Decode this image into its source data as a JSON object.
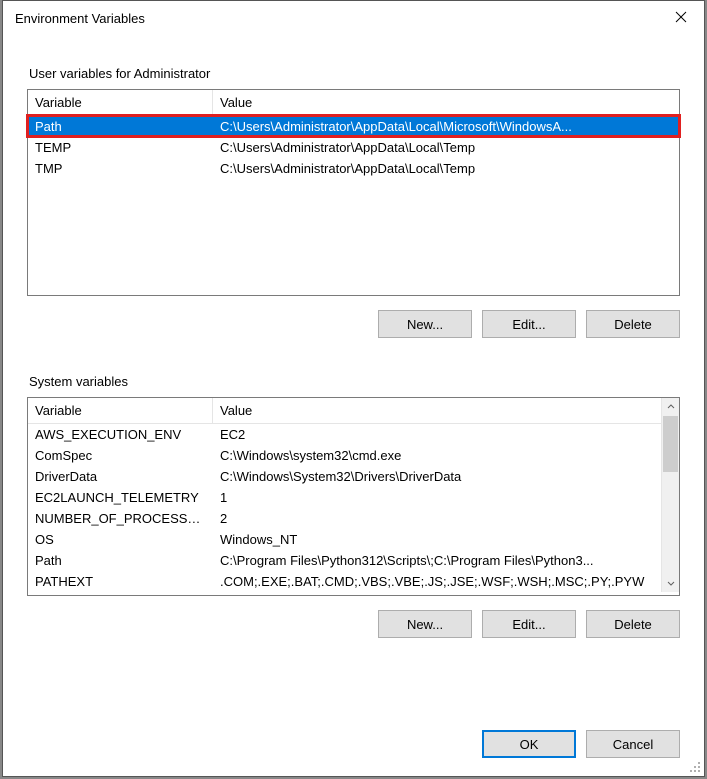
{
  "window": {
    "title": "Environment Variables"
  },
  "user_section": {
    "label": "User variables for Administrator",
    "headers": {
      "variable": "Variable",
      "value": "Value"
    },
    "rows": [
      {
        "variable": "Path",
        "value": "C:\\Users\\Administrator\\AppData\\Local\\Microsoft\\WindowsA...",
        "selected": true,
        "highlight": true
      },
      {
        "variable": "TEMP",
        "value": "C:\\Users\\Administrator\\AppData\\Local\\Temp",
        "selected": false
      },
      {
        "variable": "TMP",
        "value": "C:\\Users\\Administrator\\AppData\\Local\\Temp",
        "selected": false
      }
    ],
    "buttons": {
      "new": "New...",
      "edit": "Edit...",
      "delete": "Delete"
    }
  },
  "system_section": {
    "label": "System variables",
    "headers": {
      "variable": "Variable",
      "value": "Value"
    },
    "rows": [
      {
        "variable": "AWS_EXECUTION_ENV",
        "value": "EC2"
      },
      {
        "variable": "ComSpec",
        "value": "C:\\Windows\\system32\\cmd.exe"
      },
      {
        "variable": "DriverData",
        "value": "C:\\Windows\\System32\\Drivers\\DriverData"
      },
      {
        "variable": "EC2LAUNCH_TELEMETRY",
        "value": "1"
      },
      {
        "variable": "NUMBER_OF_PROCESSORS",
        "value": "2"
      },
      {
        "variable": "OS",
        "value": "Windows_NT"
      },
      {
        "variable": "Path",
        "value": "C:\\Program Files\\Python312\\Scripts\\;C:\\Program Files\\Python3..."
      },
      {
        "variable": "PATHEXT",
        "value": ".COM;.EXE;.BAT;.CMD;.VBS;.VBE;.JS;.JSE;.WSF;.WSH;.MSC;.PY;.PYW"
      }
    ],
    "buttons": {
      "new": "New...",
      "edit": "Edit...",
      "delete": "Delete"
    }
  },
  "dialog_buttons": {
    "ok": "OK",
    "cancel": "Cancel"
  }
}
